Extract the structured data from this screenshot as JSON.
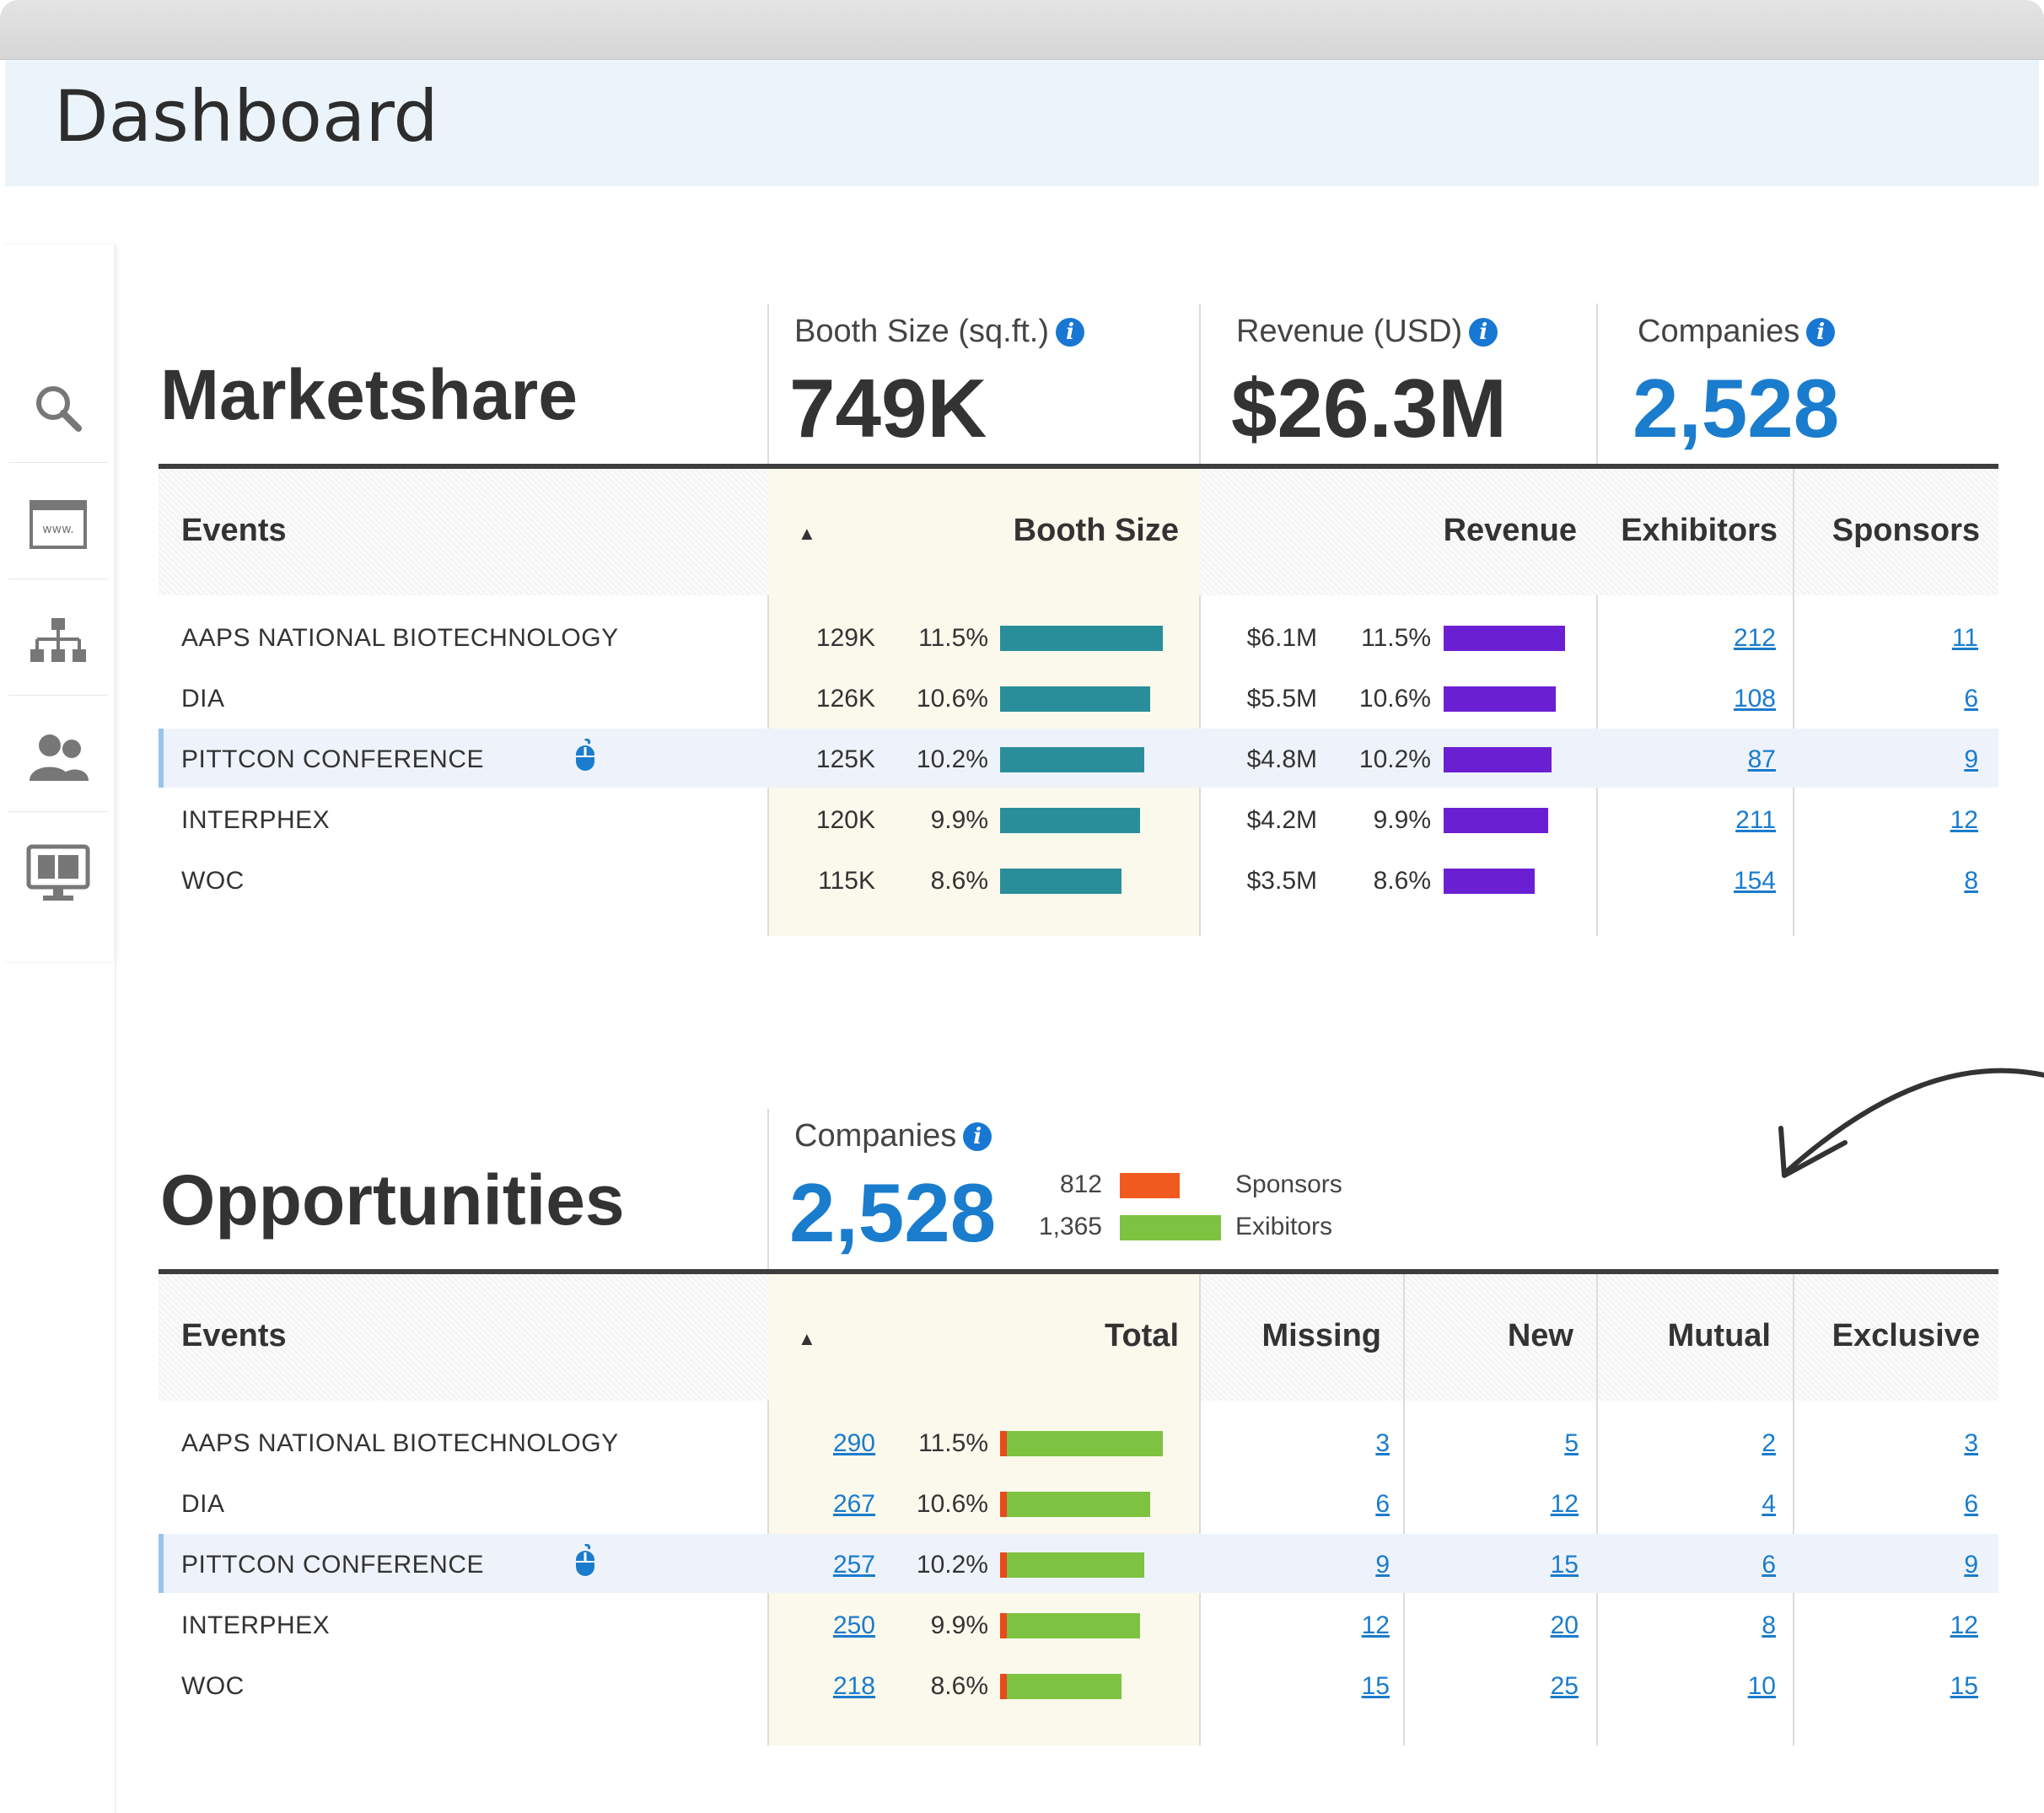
{
  "page": {
    "title": "Dashboard"
  },
  "sidebar": {
    "icons": [
      "search-icon",
      "website-icon",
      "org-chart-icon",
      "people-icon",
      "monitor-icon"
    ]
  },
  "marketshare": {
    "title": "Marketshare",
    "metrics": [
      {
        "label": "Booth Size (sq.ft.)",
        "value": "749K"
      },
      {
        "label": "Revenue (USD)",
        "value": "$26.3M"
      },
      {
        "label": "Companies",
        "value": "2,528"
      }
    ],
    "columns": {
      "events": "Events",
      "booth": "Booth Size",
      "revenue": "Revenue",
      "exhibitors": "Exhibitors",
      "sponsors": "Sponsors"
    },
    "sort_indicator": "▲",
    "rows": [
      {
        "event": "AAPS NATIONAL BIOTECHNOLOGY",
        "booth": "129K",
        "booth_pct": "11.5%",
        "booth_share": 11.5,
        "revenue": "$6.1M",
        "rev_pct": "11.5%",
        "rev_share": 11.5,
        "exhibitors": "212",
        "sponsors": "11"
      },
      {
        "event": "DIA",
        "booth": "126K",
        "booth_pct": "10.6%",
        "booth_share": 10.6,
        "revenue": "$5.5M",
        "rev_pct": "10.6%",
        "rev_share": 10.6,
        "exhibitors": "108",
        "sponsors": "6"
      },
      {
        "event": "PITTCON CONFERENCE",
        "booth": "125K",
        "booth_pct": "10.2%",
        "booth_share": 10.2,
        "revenue": "$4.8M",
        "rev_pct": "10.2%",
        "rev_share": 10.2,
        "exhibitors": "87",
        "sponsors": "9"
      },
      {
        "event": "INTERPHEX",
        "booth": "120K",
        "booth_pct": "9.9%",
        "booth_share": 9.9,
        "revenue": "$4.2M",
        "rev_pct": "9.9%",
        "rev_share": 9.9,
        "exhibitors": "211",
        "sponsors": "12"
      },
      {
        "event": "WOC",
        "booth": "115K",
        "booth_pct": "8.6%",
        "booth_share": 8.6,
        "revenue": "$3.5M",
        "rev_pct": "8.6%",
        "rev_share": 8.6,
        "exhibitors": "154",
        "sponsors": "8"
      }
    ]
  },
  "opportunities": {
    "title": "Opportunities",
    "metric": {
      "label": "Companies",
      "value": "2,528"
    },
    "legend": [
      {
        "count": "812",
        "label": "Sponsors",
        "value": 812,
        "color": "#f15a1f"
      },
      {
        "count": "1,365",
        "label": "Exibitors",
        "value": 1365,
        "color": "#7dc241"
      }
    ],
    "columns": {
      "events": "Events",
      "total": "Total",
      "missing": "Missing",
      "new": "New",
      "mutual": "Mutual",
      "exclusive": "Exclusive"
    },
    "sort_indicator": "▲",
    "rows": [
      {
        "event": "AAPS NATIONAL BIOTECHNOLOGY",
        "total": "290",
        "pct": "11.5%",
        "share": 11.5,
        "missing": "3",
        "new": "5",
        "mutual": "2",
        "exclusive": "3"
      },
      {
        "event": "DIA",
        "total": "267",
        "pct": "10.6%",
        "share": 10.6,
        "missing": "6",
        "new": "12",
        "mutual": "4",
        "exclusive": "6"
      },
      {
        "event": "PITTCON CONFERENCE",
        "total": "257",
        "pct": "10.2%",
        "share": 10.2,
        "missing": "9",
        "new": "15",
        "mutual": "6",
        "exclusive": "9"
      },
      {
        "event": "INTERPHEX",
        "total": "250",
        "pct": "9.9%",
        "share": 9.9,
        "missing": "12",
        "new": "20",
        "mutual": "8",
        "exclusive": "12"
      },
      {
        "event": "WOC",
        "total": "218",
        "pct": "8.6%",
        "share": 8.6,
        "missing": "15",
        "new": "25",
        "mutual": "10",
        "exclusive": "15"
      }
    ]
  },
  "highlighted_event": "PITTCON CONFERENCE",
  "colors": {
    "accent": "#1a7ccd",
    "booth_bar": "#2a8e9a",
    "revenue_bar": "#6b1fd2",
    "total_bar": "#7dc241",
    "total_bar_marker": "#e8491d",
    "highlight_row": "#eef3fb",
    "sorted_column": "#fbf8ec"
  }
}
